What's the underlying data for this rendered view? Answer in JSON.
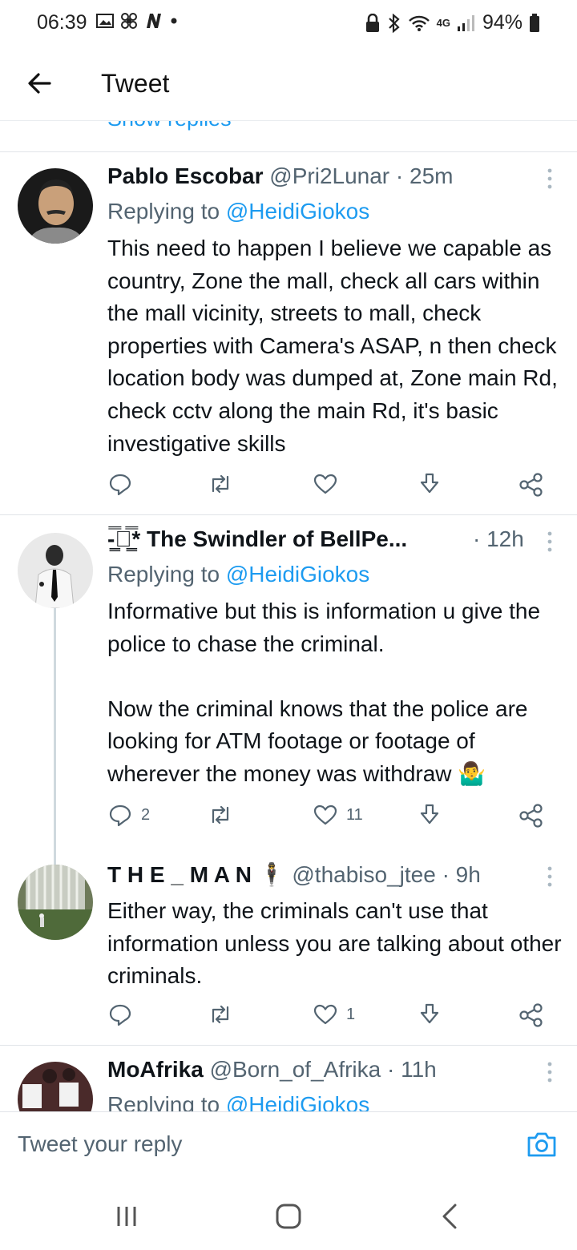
{
  "status": {
    "time": "06:39",
    "battery": "94%",
    "network": "4G"
  },
  "appbar": {
    "title": "Tweet"
  },
  "show_replies": "Show replies",
  "colors": {
    "accent": "#1d9bf0",
    "muted": "#536471",
    "text": "#0f1419"
  },
  "tweets": [
    {
      "name": "Pablo Escobar",
      "handle": "@Pri2Lunar",
      "time": "· 25m",
      "replying_prefix": "Replying to ",
      "replying_to": "@HeidiGiokos",
      "text": "This need to happen I believe we capable as country, Zone the mall, check all cars within the mall vicinity, streets to mall, check properties with Camera's ASAP, n then check location body was dumped at, Zone main Rd, check cctv along the main Rd, it's basic investigative skills",
      "replies": "",
      "retweets": "",
      "likes": ""
    },
    {
      "name": "-͇̿⏛͇̿* The Swindler of BellPe...",
      "handle": "",
      "time": "· 12h",
      "replying_prefix": "Replying to ",
      "replying_to": "@HeidiGiokos",
      "text": "Informative but this is information u give the police to chase the criminal.\n\nNow the criminal knows that the police are looking for ATM footage or footage of wherever the money was withdraw 🤷‍♂️",
      "replies": "2",
      "retweets": "",
      "likes": "11"
    },
    {
      "name": "T H E _ M A N 🕴",
      "handle": "@thabiso_jtee",
      "time": "· 9h",
      "text": "Either way, the criminals can't use that information unless you are talking about other criminals.",
      "replies": "",
      "retweets": "",
      "likes": "1"
    },
    {
      "name": "MoAfrika",
      "handle": "@Born_of_Afrika",
      "time": "· 11h",
      "replying_prefix": "Replying to ",
      "replying_to": "@HeidiGiokos"
    }
  ],
  "reply_bar": {
    "placeholder": "Tweet your reply"
  }
}
